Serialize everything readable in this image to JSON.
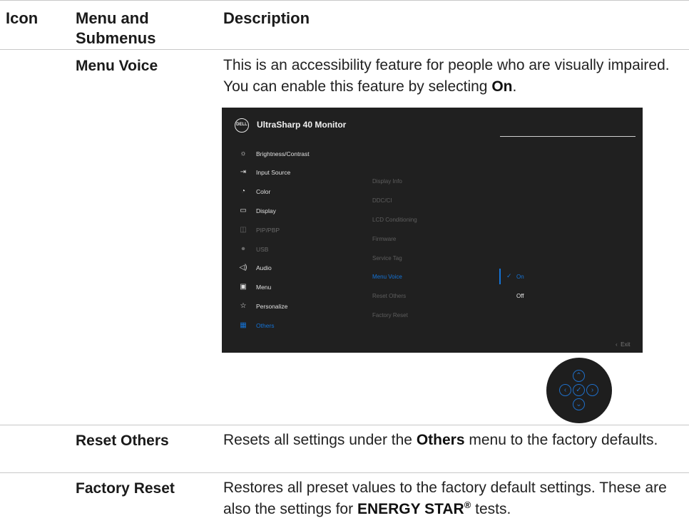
{
  "header": {
    "col_icon": "Icon",
    "col_menu_line1": "Menu and",
    "col_menu_line2": "Submenus",
    "col_description": "Description"
  },
  "rows": {
    "menu_voice": {
      "name": "Menu Voice",
      "desc_1": "This is an accessibility feature for people who are visually impaired. You can enable this feature by selecting ",
      "desc_bold": "On",
      "desc_2": "."
    },
    "reset_others": {
      "name": "Reset Others",
      "desc_1": "Resets all settings under the ",
      "desc_bold": "Others",
      "desc_2": " menu to the factory defaults."
    },
    "factory_reset": {
      "name": "Factory Reset",
      "desc_1": "Restores all preset values to the factory default settings. These are also the settings for ",
      "desc_bold": "ENERGY STAR",
      "desc_sup": "®",
      "desc_2": " tests."
    }
  },
  "osd": {
    "logo": "DELL",
    "title": "UltraSharp 40 Monitor",
    "menu": [
      {
        "icon": "brightness-icon",
        "glyph": "☼",
        "label": "Brightness/Contrast",
        "state": "normal"
      },
      {
        "icon": "input-source-icon",
        "glyph": "⇥",
        "label": "Input Source",
        "state": "normal"
      },
      {
        "icon": "color-icon",
        "glyph": "◔",
        "label": "Color",
        "state": "normal"
      },
      {
        "icon": "display-icon",
        "glyph": "▭",
        "label": "Display",
        "state": "normal"
      },
      {
        "icon": "pip-pbp-icon",
        "glyph": "◫",
        "label": "PIP/PBP",
        "state": "dim"
      },
      {
        "icon": "usb-icon",
        "glyph": "⏺",
        "label": "USB",
        "state": "dim"
      },
      {
        "icon": "audio-icon",
        "glyph": "◁)",
        "label": "Audio",
        "state": "normal"
      },
      {
        "icon": "menu-icon",
        "glyph": "▣",
        "label": "Menu",
        "state": "normal"
      },
      {
        "icon": "personalize-icon",
        "glyph": "☆",
        "label": "Personalize",
        "state": "normal"
      },
      {
        "icon": "others-icon",
        "glyph": "▦",
        "label": "Others",
        "state": "selected"
      }
    ],
    "submenu": [
      {
        "label": "Display Info",
        "state": "dim"
      },
      {
        "label": "DDC/CI",
        "state": "dim"
      },
      {
        "label": "LCD Conditioning",
        "state": "dim"
      },
      {
        "label": "Firmware",
        "state": "dim"
      },
      {
        "label": "Service Tag",
        "state": "dim"
      },
      {
        "label": "Menu Voice",
        "state": "selected"
      },
      {
        "label": "Reset Others",
        "state": "dim"
      },
      {
        "label": "Factory Reset",
        "state": "dim"
      }
    ],
    "options": {
      "on": "On",
      "off": "Off",
      "checked": "On"
    },
    "exit_label": "Exit",
    "accent_color": "#1473d6"
  },
  "joystick": {
    "up_icon": "chevron-up-icon",
    "down_icon": "chevron-down-icon",
    "left_icon": "chevron-left-icon",
    "right_icon": "chevron-right-icon",
    "center_icon": "check-icon"
  }
}
